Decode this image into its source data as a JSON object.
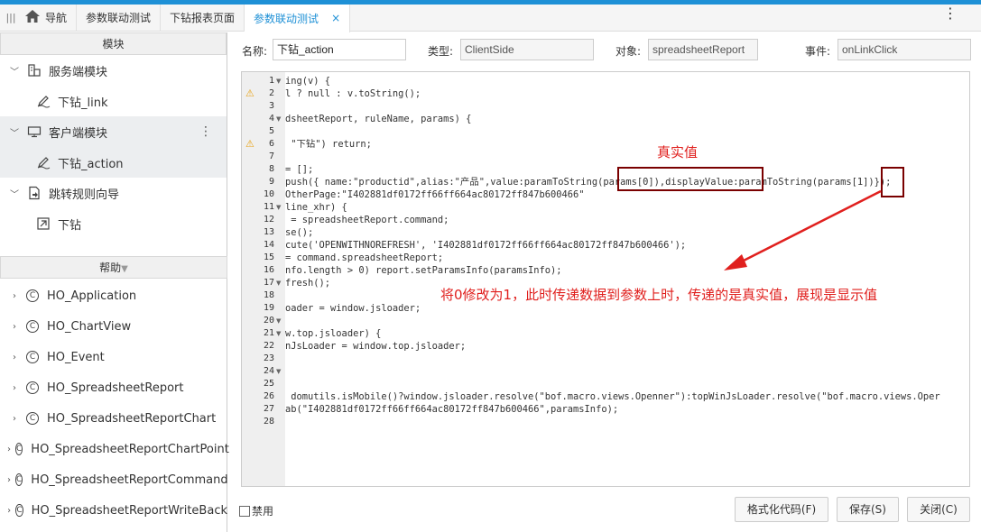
{
  "tabs": {
    "home_label": "导航",
    "items": [
      "参数联动测试",
      "下钻报表页面",
      "参数联动测试"
    ],
    "close": "×"
  },
  "module_panel": {
    "header": "模块",
    "tree": [
      {
        "label": "服务端模块",
        "level": 0
      },
      {
        "label": "下钻_link",
        "level": 1
      },
      {
        "label": "客户端模块",
        "level": 0
      },
      {
        "label": "下钻_action",
        "level": 1
      },
      {
        "label": "跳转规则向导",
        "level": 0
      },
      {
        "label": "下钻",
        "level": 1
      }
    ]
  },
  "help_panel": {
    "header": "帮助",
    "items": [
      "HO_Application",
      "HO_ChartView",
      "HO_Event",
      "HO_SpreadsheetReport",
      "HO_SpreadsheetReportChart",
      "HO_SpreadsheetReportChartPoint",
      "HO_SpreadsheetReportCommand",
      "HO_SpreadsheetReportWriteBack"
    ]
  },
  "form": {
    "name_label": "名称:",
    "name_value": "下钻_action",
    "type_label": "类型:",
    "type_value": "ClientSide",
    "object_label": "对象:",
    "object_value": "spreadsheetReport",
    "event_label": "事件:",
    "event_value": "onLinkClick"
  },
  "editor": {
    "line_numbers": [
      "1",
      "2",
      "3",
      "4",
      "5",
      "6",
      "7",
      "8",
      "9",
      "10",
      "11",
      "12",
      "13",
      "14",
      "15",
      "16",
      "17",
      "18",
      "19",
      "20",
      "21",
      "22",
      "23",
      "24",
      "25",
      "26",
      "27",
      "28"
    ],
    "code_lines": [
      "ing(v) {",
      "l ? null : v.toString();",
      "",
      "dsheetReport, ruleName, params) {",
      "",
      " \"下钻\") return;",
      "",
      "= [];",
      "push({ name:\"productid\",alias:\"产品\",value:paramToString(params[0]),displayValue:paramToString(params[1])});",
      "OtherPage:\"I402881df0172ff66ff664ac80172ff847b600466\"",
      "line_xhr) {",
      " = spreadsheetReport.command;",
      "se();",
      "cute('OPENWITHNOREFRESH', 'I402881df0172ff66ff664ac80172ff847b600466');",
      "= command.spreadsheetReport;",
      "nfo.length > 0) report.setParamsInfo(paramsInfo);",
      "fresh();",
      "",
      "oader = window.jsloader;",
      "",
      "w.top.jsloader) {",
      "nJsLoader = window.top.jsloader;",
      "",
      "",
      "",
      " domutils.isMobile()?window.jsloader.resolve(\"bof.macro.views.Openner\"):topWinJsLoader.resolve(\"bof.macro.views.Oper",
      "ab(\"I402881df0172ff66ff664ac80172ff847b600466\",paramsInfo);",
      ""
    ]
  },
  "annotations": {
    "real_value": "真实值",
    "note": "将0修改为1，此时传递数据到参数上时，传递的是真实值，展现是显示值"
  },
  "footer": {
    "disable_label": "禁用",
    "format_button": "格式化代码(F)",
    "save_button": "保存(S)",
    "close_button": "关闭(C)"
  },
  "colors": {
    "accent": "#1e90d6",
    "annotation_red": "#e0201e",
    "box_dark_red": "#7a0000"
  }
}
